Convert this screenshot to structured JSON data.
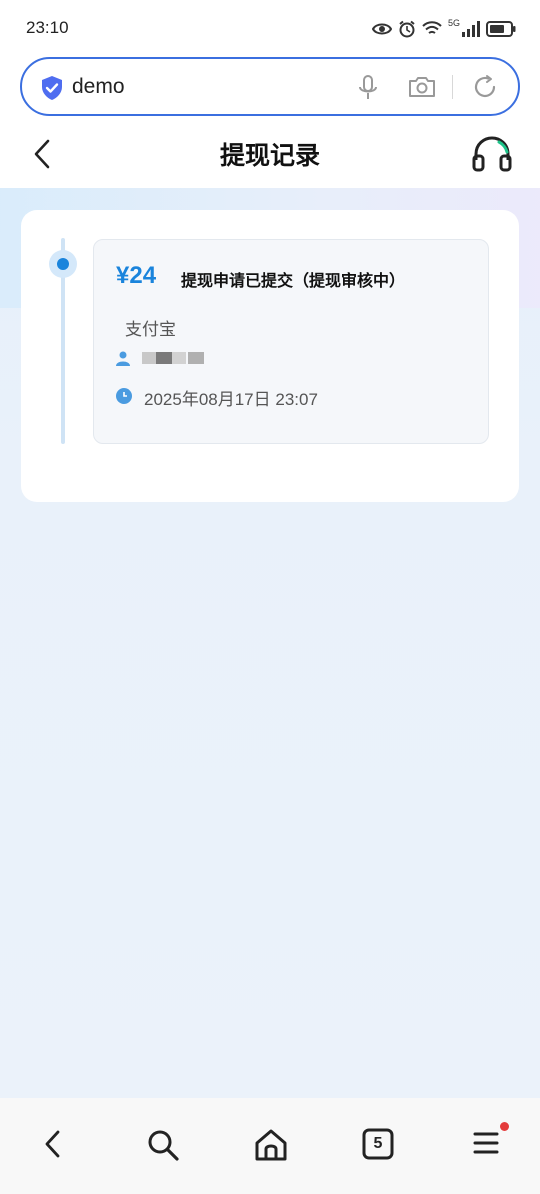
{
  "status_bar": {
    "time": "23:10",
    "network_label": "5G"
  },
  "address_bar": {
    "url_text": "demo"
  },
  "header": {
    "title": "提现记录"
  },
  "record": {
    "amount": "¥24",
    "status": "提现申请已提交（提现审核中）",
    "method": "支付宝",
    "datetime": "2025年08月17日 23:07"
  },
  "bottom_bar": {
    "tab_count": "5"
  },
  "colors": {
    "accent": "#1a84dc",
    "address_border": "#3b6fe0",
    "notification_dot": "#e43c3c"
  },
  "icons": [
    "eye-icon",
    "alarm-icon",
    "wifi-icon",
    "signal-icon",
    "battery-icon",
    "shield-icon",
    "mic-icon",
    "camera-icon",
    "refresh-icon",
    "back-icon",
    "headset-icon",
    "user-icon",
    "clock-icon",
    "search-icon",
    "home-icon",
    "tabs-icon",
    "menu-icon"
  ]
}
